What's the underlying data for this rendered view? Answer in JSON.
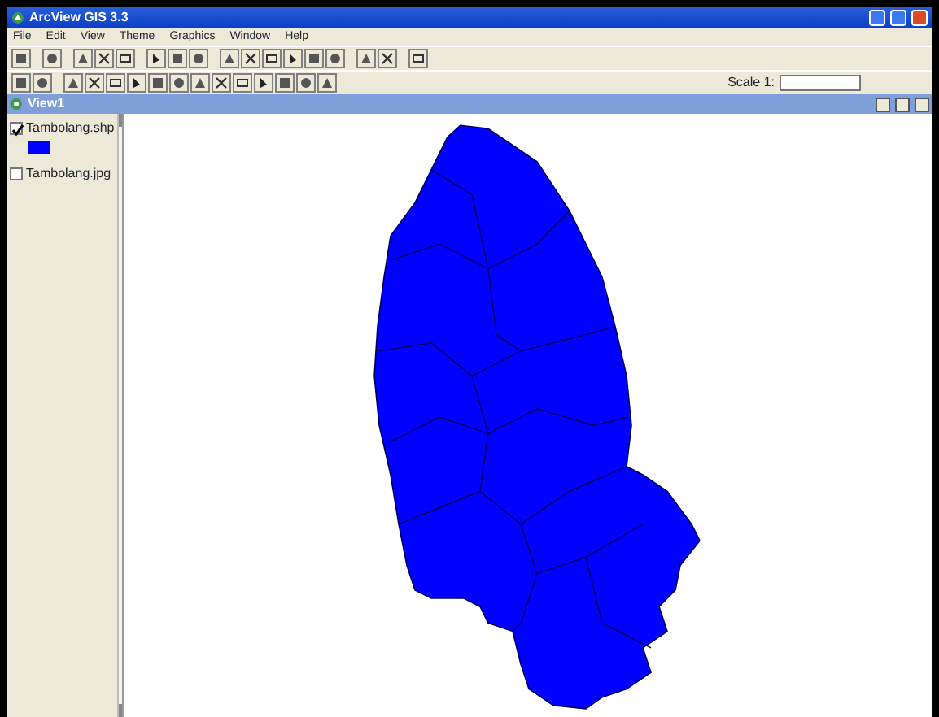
{
  "window": {
    "title": "ArcView GIS 3.3"
  },
  "menu": [
    "File",
    "Edit",
    "View",
    "Theme",
    "Graphics",
    "Window",
    "Help"
  ],
  "scale": {
    "label": "Scale 1:"
  },
  "view": {
    "title": "View1"
  },
  "themes": [
    {
      "name": "Tambolang.shp",
      "checked": true,
      "color": "#0000ff"
    },
    {
      "name": "Tambolang.jpg",
      "checked": false
    }
  ]
}
